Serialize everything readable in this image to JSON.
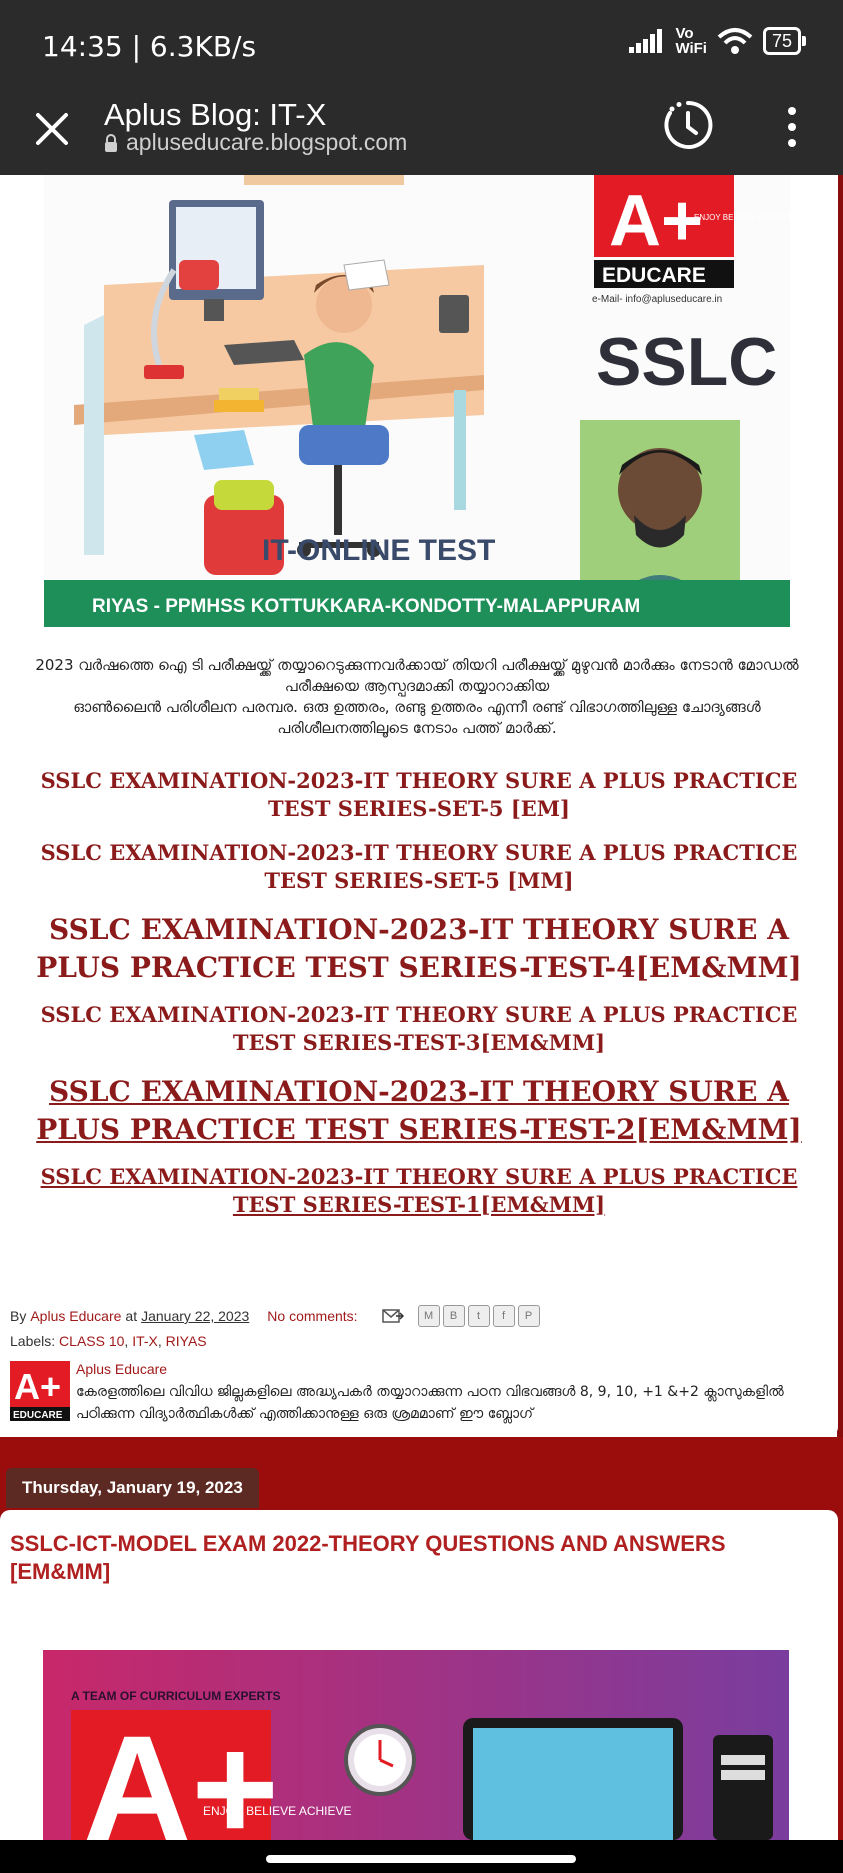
{
  "status": {
    "time": "14:35 | 6.3KB/s",
    "vowifi_top": "Vo",
    "vowifi_bottom": "WiFi",
    "battery": "75"
  },
  "toolbar": {
    "title": "Aplus Blog: IT-X",
    "url": "apluseducare.blogspot.com"
  },
  "banner": {
    "logo_text": "A+",
    "logo_tagline": "ENJOY BELIEVE ACHIEVE",
    "brand": "EDUCARE",
    "email": "e-Mail- info@apluseducare.in",
    "exam": "SSLC",
    "test_label": "IT-ONLINE TEST",
    "footer": "RIYAS - PPMHSS KOTTUKKARA-KONDOTTY-MALAPPURAM"
  },
  "intro": {
    "line1": "2023 വർഷത്തെ ഐ ടി പരീക്ഷയ്ക്ക്  തയ്യാറെടുക്കുന്നവർക്കായ് തിയറി പരീക്ഷയ്ക്ക് മുഴുവൻ മാർക്കും നേടാൻ  മോഡൽ പരീക്ഷയെ ആസ്പദമാക്കി തയ്യാറാക്കിയ",
    "line2": "ഓൺലൈൻ പരിശീലന പരമ്പര.  ഒരു ഉത്തരം, രണ്ടു ഉത്തരം  എന്നീ രണ്ട് വിഭാഗത്തിലുള്ള ചോദ്യങ്ങൾ പരിശീലനത്തിലൂടെ നേടാം പത്ത് മാർക്ക്."
  },
  "links": [
    "SSLC EXAMINATION-2023-IT THEORY SURE A PLUS PRACTICE TEST SERIES-SET-5 [EM]",
    "SSLC EXAMINATION-2023-IT THEORY SURE A PLUS PRACTICE TEST SERIES-SET-5 [MM]",
    "SSLC EXAMINATION-2023-IT THEORY SURE A PLUS PRACTICE TEST SERIES-TEST-4[EM&MM]",
    "SSLC EXAMINATION-2023-IT THEORY SURE A PLUS PRACTICE TEST SERIES-TEST-3[EM&MM]",
    " SSLC EXAMINATION-2023-IT THEORY SURE A PLUS PRACTICE TEST SERIES-TEST-2[EM&MM]",
    " SSLC EXAMINATION-2023-IT THEORY SURE A PLUS PRACTICE TEST SERIES-TEST-1[EM&MM]"
  ],
  "meta": {
    "by": "By",
    "author": "Aplus Educare",
    "at": "at",
    "date": "January 22, 2023",
    "comments": "No comments:",
    "share": [
      "M",
      "B",
      "t",
      "f",
      "P"
    ]
  },
  "labels": {
    "prefix": "Labels:",
    "items": [
      "CLASS 10",
      "IT-X",
      "RIYAS"
    ]
  },
  "author_box": {
    "name": "Aplus Educare",
    "logo_text": "A+",
    "logo_brand": "EDUCARE",
    "desc": "കേരളത്തിലെ വിവിധ ജില്ലകളിലെ അദ്ധ്യപകർ തയ്യാറാക്കുന്ന പഠന വിഭവങ്ങൾ 8, 9, 10, +1 &+2 ക്ലാസുകളിൽ പഠിക്കുന്ന വിദ്യാർത്ഥികൾക്ക് എത്തിക്കാനുള്ള ഒരു ശ്രമമാണ് ഈ ബ്ലോഗ്"
  },
  "post2": {
    "date": "Thursday, January 19, 2023",
    "title": "SSLC-ICT-MODEL EXAM 2022-THEORY QUESTIONS AND ANSWERS [EM&MM]",
    "banner_caption": "A TEAM OF CURRICULUM EXPERTS",
    "logo_text": "A+",
    "logo_tagline": "ENJOY BELIEVE ACHIEVE"
  },
  "colors": {
    "accent": "#8b1a1a",
    "section_red": "#9b0d0d",
    "toolbar": "#2b2b2b"
  }
}
